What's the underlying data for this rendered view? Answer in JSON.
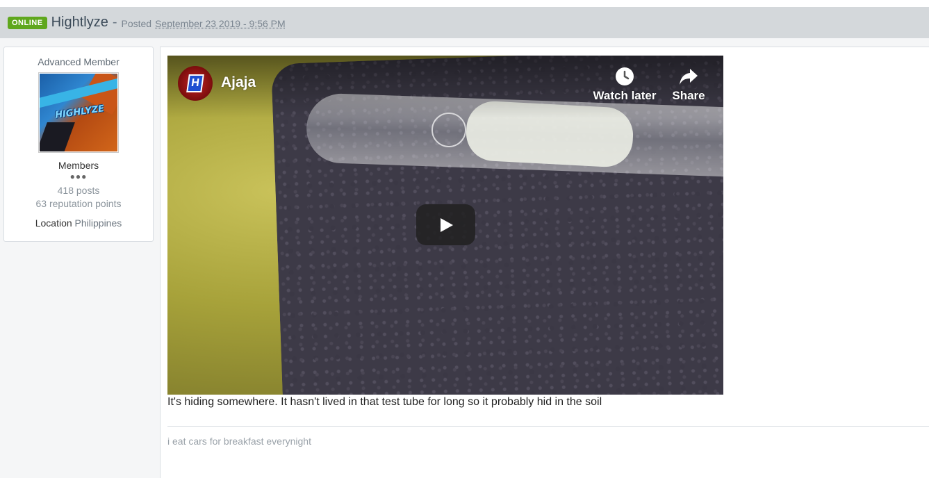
{
  "post_header": {
    "online_badge": "ONLINE",
    "author_name": "Hightlyze",
    "separator": "-",
    "posted_label": "Posted",
    "posted_date": "September 23 2019 - 9:56 PM"
  },
  "author_panel": {
    "member_title": "Advanced Member",
    "avatar_text": "HIGHLYZE",
    "group_name": "Members",
    "rank_pips": "●●●",
    "posts": "418 posts",
    "reputation": "63 reputation points",
    "location_label": "Location",
    "location_value": "Philippines"
  },
  "video": {
    "channel_initial": "H",
    "title": "Ajaja",
    "watch_later_label": "Watch later",
    "share_label": "Share"
  },
  "post": {
    "body_text": "It's hiding somewhere. It hasn't lived in that test tube for long so it probably hid in the soil",
    "signature": "i eat cars for breakfast everynight"
  },
  "colors": {
    "online_badge": "#5fa71d",
    "header_bg": "#d4d8db",
    "play_button": "#212121"
  }
}
